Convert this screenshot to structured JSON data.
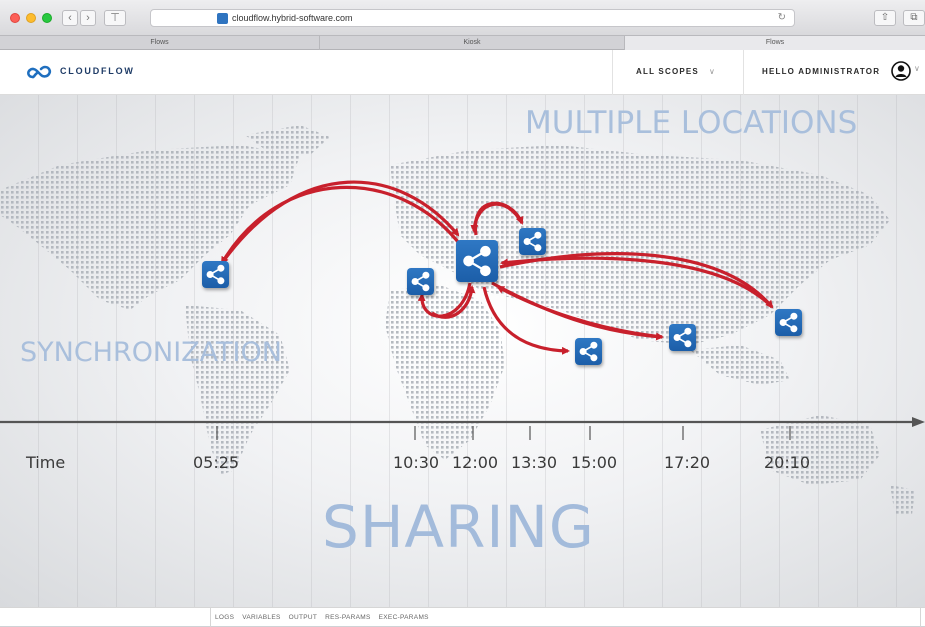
{
  "browser": {
    "url": "cloudflow.hybrid-software.com",
    "tabs": [
      "Flows",
      "Kiosk",
      "Flows"
    ]
  },
  "header": {
    "brand": "CLOUDFLOW",
    "scopes": "ALL SCOPES",
    "greeting": "HELLO ADMINISTRATOR",
    "brand_color": "#1e3b66"
  },
  "illustration": {
    "top_label": "MULTIPLE LOCATIONS",
    "left_label": "SYNCHRONIZATION",
    "bottom_label": "SHARING",
    "timeline": {
      "title": "Time",
      "ticks": [
        "05:25",
        "10:30",
        "12:00",
        "13:30",
        "15:00",
        "17:20",
        "20:10"
      ]
    },
    "colors": {
      "node": "#2f78c4",
      "arrow": "#c8202c",
      "label": "#a9bfdc"
    }
  },
  "bottom_panel": {
    "tabs": [
      "LOGS",
      "VARIABLES",
      "OUTPUT",
      "RES-PARAMS",
      "EXEC-PARAMS"
    ]
  }
}
